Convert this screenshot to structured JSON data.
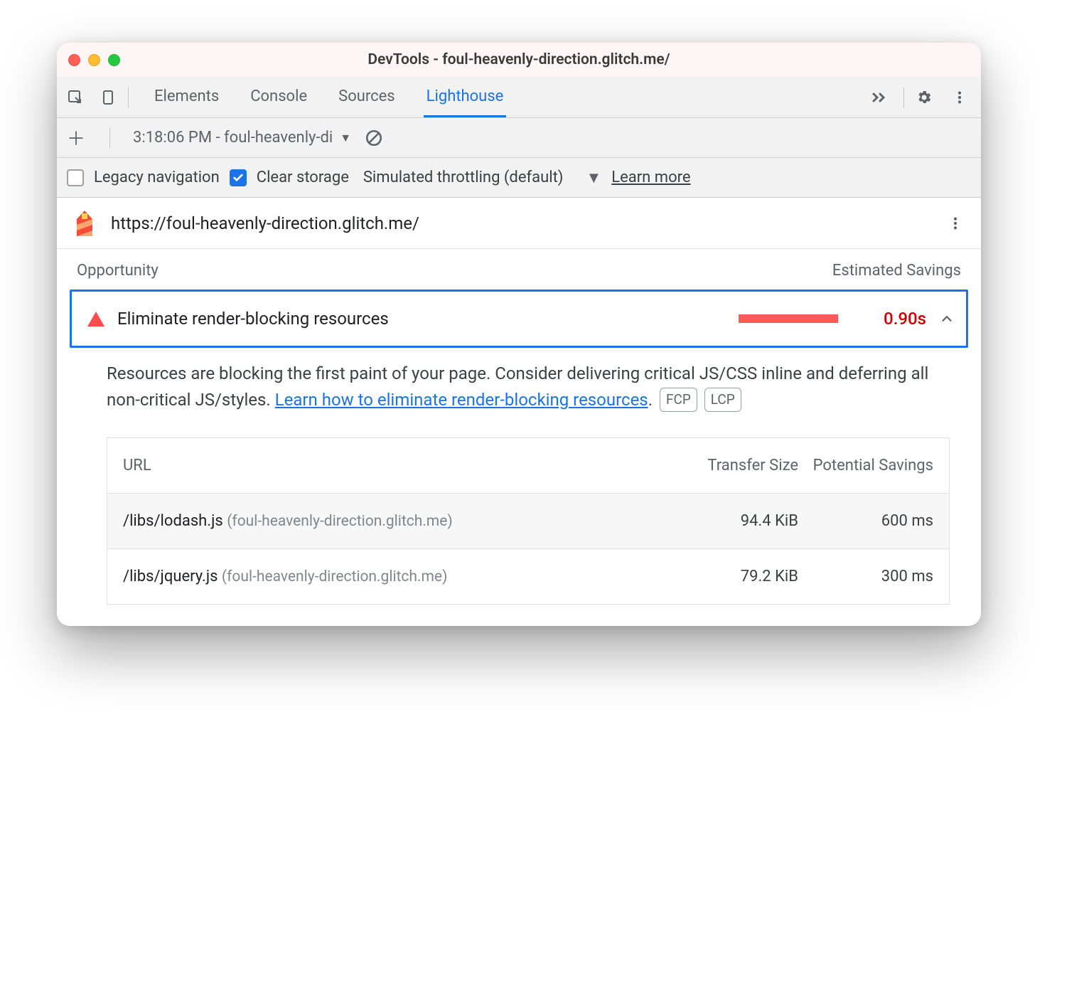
{
  "title": "DevTools - foul-heavenly-direction.glitch.me/",
  "tabs": [
    "Elements",
    "Console",
    "Sources",
    "Lighthouse"
  ],
  "active_tab_index": 3,
  "subbar1": {
    "report_label": "3:18:06 PM - foul-heavenly-di"
  },
  "subbar2": {
    "legacy_label": "Legacy navigation",
    "legacy_checked": false,
    "clear_label": "Clear storage",
    "clear_checked": true,
    "throttle_label": "Simulated throttling (default)",
    "learn_more": "Learn more"
  },
  "urlbar": {
    "url": "https://foul-heavenly-direction.glitch.me/"
  },
  "section": {
    "opportunity_label": "Opportunity",
    "estimated_label": "Estimated Savings"
  },
  "audit": {
    "title": "Eliminate render-blocking resources",
    "savings": "0.90s",
    "desc_before": "Resources are blocking the first paint of your page. Consider delivering critical JS/CSS inline and deferring all non-critical JS/styles. ",
    "desc_link": "Learn how to eliminate render-blocking resources",
    "desc_after": ".",
    "chip1": "FCP",
    "chip2": "LCP"
  },
  "details": {
    "col_url": "URL",
    "col_size": "Transfer Size",
    "col_savings": "Potential Savings",
    "rows": [
      {
        "path": "/libs/lodash.js",
        "host": "(foul-heavenly-direction.glitch.me)",
        "size": "94.4 KiB",
        "savings": "600 ms"
      },
      {
        "path": "/libs/jquery.js",
        "host": "(foul-heavenly-direction.glitch.me)",
        "size": "79.2 KiB",
        "savings": "300 ms"
      }
    ]
  }
}
